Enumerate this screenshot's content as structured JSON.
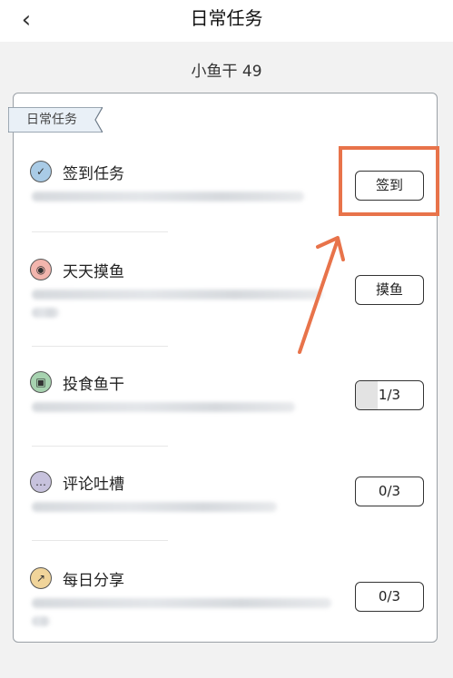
{
  "header": {
    "title": "日常任务",
    "back_icon": "chevron-left-icon"
  },
  "points": {
    "label": "小鱼干 49"
  },
  "card": {
    "ribbon_label": "日常任务",
    "tasks": [
      {
        "name": "签到任务",
        "icon": "calendar-check-icon",
        "icon_color": "#a9cbe6",
        "button": "签到",
        "progress": null
      },
      {
        "name": "天天摸鱼",
        "icon": "fish-icon",
        "icon_color": "#f2b5ad",
        "button": "摸鱼",
        "progress": null
      },
      {
        "name": "投食鱼干",
        "icon": "feed-icon",
        "icon_color": "#a7d3b0",
        "button": "1/3",
        "progress": 0.3333
      },
      {
        "name": "评论吐槽",
        "icon": "chat-bubble-icon",
        "icon_color": "#c7c2dd",
        "button": "0/3",
        "progress": 0
      },
      {
        "name": "每日分享",
        "icon": "share-icon",
        "icon_color": "#f0d49a",
        "button": "0/3",
        "progress": 0
      }
    ]
  },
  "annotation": {
    "color": "#e8734a"
  }
}
